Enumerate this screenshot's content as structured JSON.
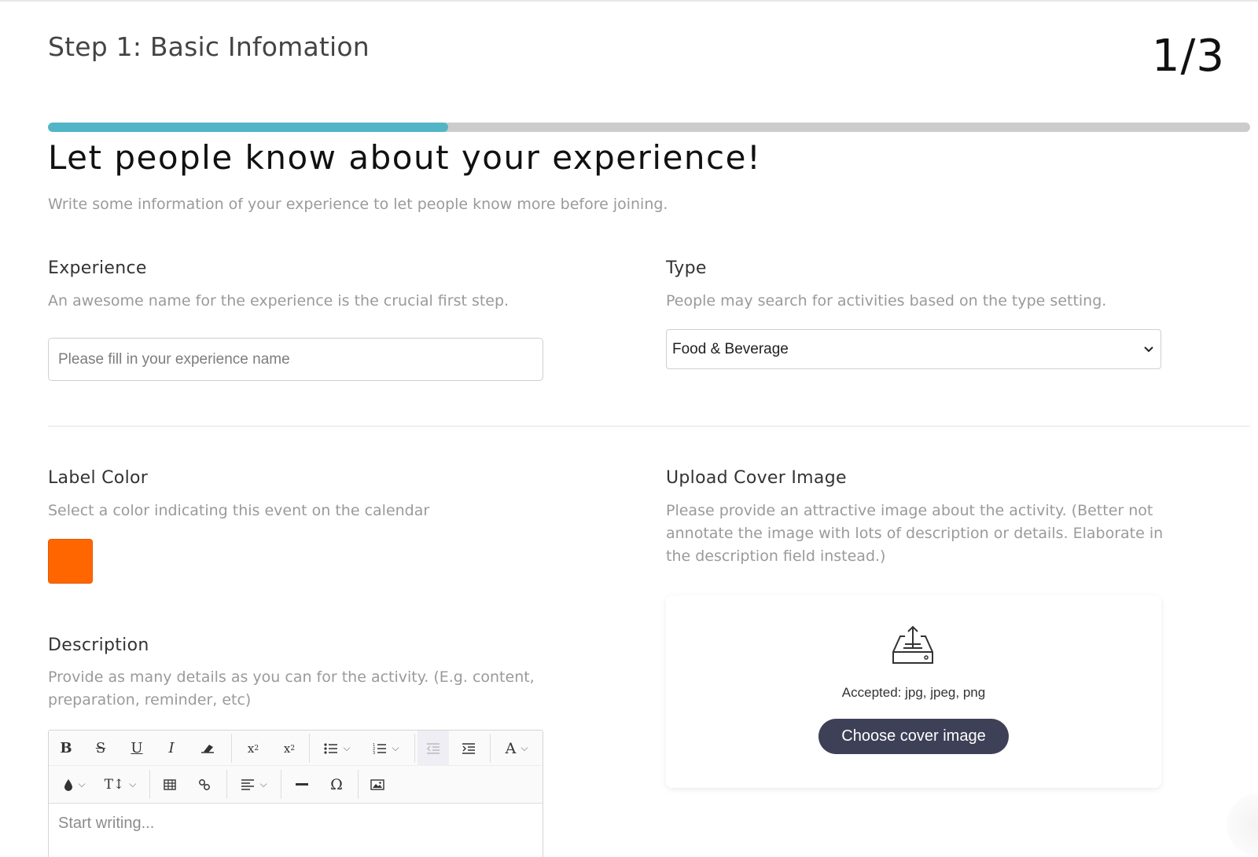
{
  "header": {
    "step_title": "Step 1: Basic Infomation",
    "step_counter": "1/3",
    "progress": 0.333
  },
  "intro": {
    "heading": "Let people know about your experience!",
    "subheading": "Write some information of your experience to let people know more before joining."
  },
  "experience": {
    "label": "Experience",
    "hint": "An awesome name for the experience is the crucial first step.",
    "placeholder": "Please fill in your experience name",
    "value": ""
  },
  "type": {
    "label": "Type",
    "hint": "People may search for activities based on the type setting.",
    "selected": "Food & Beverage"
  },
  "label_color": {
    "label": "Label Color",
    "hint": "Select a color indicating this event on the calendar",
    "color": "#ff6600"
  },
  "cover_image": {
    "label": "Upload Cover Image",
    "hint": "Please provide an attractive image about the activity. (Better not annotate the image with lots of description or details. Elaborate in the description field instead.)",
    "accepted": "Accepted: jpg, jpeg, png",
    "button_label": "Choose cover image",
    "icon": "upload-tray-icon"
  },
  "description": {
    "label": "Description",
    "hint": "Provide as many details as you can for the activity. (E.g. content, preparation, reminder, etc)",
    "placeholder": "Start writing...",
    "toolbar_icons": [
      "bold-icon",
      "strikethrough-icon",
      "underline-icon",
      "italic-icon",
      "eraser-icon",
      "superscript-icon",
      "subscript-icon",
      "bullet-list-icon",
      "numbered-list-icon",
      "outdent-icon",
      "indent-icon",
      "font-color-icon",
      "fill-color-icon",
      "font-size-icon",
      "table-icon",
      "link-icon",
      "align-icon",
      "horizontal-rule-icon",
      "special-char-icon",
      "image-icon"
    ]
  },
  "colors": {
    "progress_fill": "#52b5c7",
    "progress_track": "#cccccc",
    "button_bg": "#3e4057"
  }
}
